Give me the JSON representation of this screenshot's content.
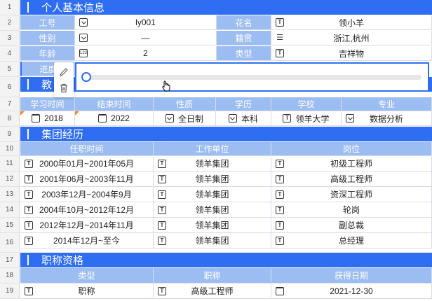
{
  "row_numbers": [
    "1",
    "2",
    "3",
    "4",
    "5",
    "6",
    "7",
    "8",
    "9",
    "10",
    "11",
    "12",
    "13",
    "14",
    "15",
    "16",
    "17",
    "18",
    "19"
  ],
  "sections": {
    "personal": "个人基本信息",
    "education": "教",
    "career": "集团经历",
    "title_qual": "职称资格"
  },
  "personal": {
    "id_label": "工号",
    "id_value": "ly001",
    "nickname_label": "花名",
    "nickname_value": "领小羊",
    "gender_label": "性别",
    "gender_value": "—",
    "origin_label": "籍贯",
    "origin_value": "浙江,杭州",
    "age_label": "年龄",
    "age_value": "2",
    "type_label": "类型",
    "type_value": "吉祥物",
    "progress_label": "进度",
    "progress_value": 0
  },
  "education": {
    "headers": [
      "学习时间",
      "结束时间",
      "性质",
      "学历",
      "学校",
      "专业"
    ],
    "row": [
      "2018",
      "2022",
      "全日制",
      "本科",
      "领羊大学",
      "数据分析"
    ]
  },
  "career": {
    "headers": [
      "任职时间",
      "工作单位",
      "岗位"
    ],
    "rows": [
      [
        "2000年01月~2001年05月",
        "领羊集团",
        "初级工程师"
      ],
      [
        "2001年06月~2003年11月",
        "领羊集团",
        "高级工程师"
      ],
      [
        "2003年12月~2004年9月",
        "领羊集团",
        "资深工程师"
      ],
      [
        "2004年10月~2012年12月",
        "领羊集团",
        "轮岗"
      ],
      [
        "2012年12月~2014年11月",
        "领羊集团",
        "副总裁"
      ],
      [
        "2014年12月~至今",
        "领羊集团",
        "总经理"
      ]
    ]
  },
  "qualification": {
    "headers": [
      "类型",
      "职称",
      "获得日期"
    ],
    "row": [
      "职称",
      "高级工程师",
      "2021-12-30"
    ]
  },
  "icons": {
    "edit": "pencil-icon",
    "delete": "trash-icon",
    "cursor": "hand-cursor-icon"
  },
  "colors": {
    "accent": "#2f6ef2",
    "label_bg": "#9cbdf2"
  }
}
